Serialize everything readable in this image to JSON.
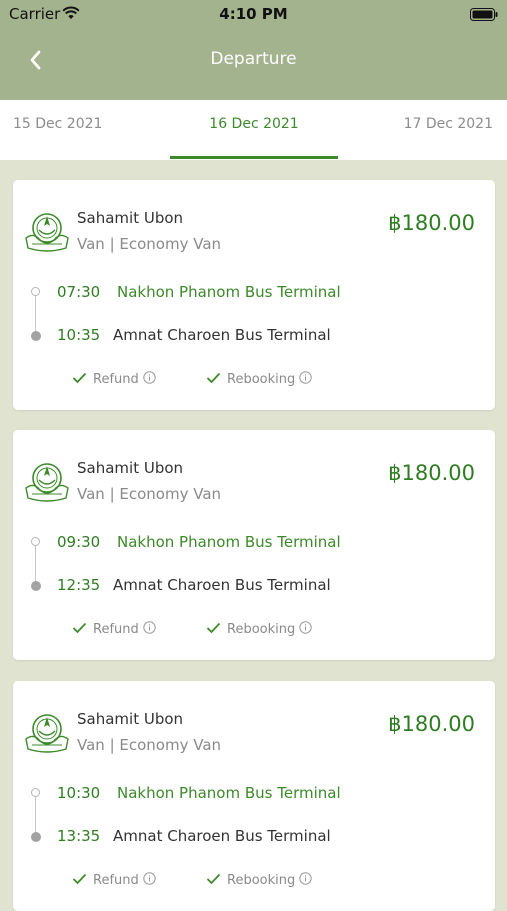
{
  "status_bar": {
    "carrier": "Carrier",
    "time": "4:10 PM"
  },
  "nav": {
    "title": "Departure"
  },
  "dates": {
    "prev": "15 Dec 2021",
    "active": "16 Dec 2021",
    "next": "17 Dec 2021"
  },
  "colors": {
    "header": "#a3b38e",
    "accent": "#3d8a2b",
    "background": "#dfe3d0"
  },
  "trips": [
    {
      "operator": "Sahamit Ubon",
      "vehicle": "Van | Economy Van",
      "price": "฿180.00",
      "departure_time": "07:30",
      "departure_place": "Nakhon Phanom Bus Terminal",
      "arrival_time": "10:35",
      "arrival_place": "Amnat Charoen Bus Terminal",
      "refund": "Refund",
      "rebooking": "Rebooking"
    },
    {
      "operator": "Sahamit Ubon",
      "vehicle": "Van | Economy Van",
      "price": "฿180.00",
      "departure_time": "09:30",
      "departure_place": "Nakhon Phanom Bus Terminal",
      "arrival_time": "12:35",
      "arrival_place": "Amnat Charoen Bus Terminal",
      "refund": "Refund",
      "rebooking": "Rebooking"
    },
    {
      "operator": "Sahamit Ubon",
      "vehicle": "Van | Economy Van",
      "price": "฿180.00",
      "departure_time": "10:30",
      "departure_place": "Nakhon Phanom Bus Terminal",
      "arrival_time": "13:35",
      "arrival_place": "Amnat Charoen Bus Terminal",
      "refund": "Refund",
      "rebooking": "Rebooking"
    }
  ],
  "icons": {
    "back": "chevron-left-icon",
    "wifi": "wifi-icon",
    "battery": "battery-icon",
    "logo": "operator-logo",
    "check": "check-icon",
    "info": "info-icon"
  }
}
